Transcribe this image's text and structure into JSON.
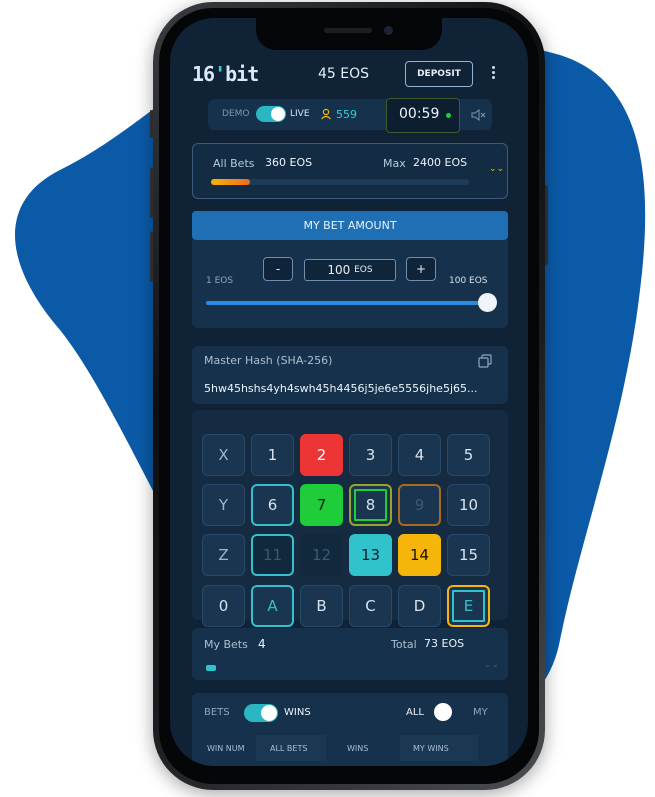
{
  "header": {
    "logo_a": "16",
    "logo_b": "bit",
    "balance": "45 EOS",
    "deposit_label": "DEPOSIT"
  },
  "mode": {
    "demo_label": "DEMO",
    "live_label": "LIVE",
    "players": "559",
    "timer": "00:59"
  },
  "all_bets": {
    "label": "All Bets",
    "value": "360 EOS",
    "max_label": "Max",
    "max_value": "2400 EOS",
    "progress": 0.15
  },
  "my_bet": {
    "title": "MY BET AMOUNT",
    "min_label": "1 EOS",
    "max_label": "100 EOS",
    "minus": "-",
    "plus": "+",
    "amount": "100",
    "unit": "EOS",
    "slider_value": 1.0
  },
  "hash": {
    "label": "Master Hash (SHA-256)",
    "value": "5hw45hshs4yh4swh45h4456j5je6e5556jhe5j65..."
  },
  "grid": {
    "cells": [
      [
        "X",
        "1",
        "2",
        "3",
        "4",
        "5"
      ],
      [
        "Y",
        "6",
        "7",
        "8",
        "9",
        "10"
      ],
      [
        "Z",
        "11",
        "12",
        "13",
        "14",
        "15"
      ],
      [
        "0",
        "A",
        "B",
        "C",
        "D",
        "E"
      ]
    ],
    "colors": {
      "red": "#ee3535",
      "green": "#1fcc3a",
      "cyan": "#31c3cc",
      "orange": "#f5b50a"
    }
  },
  "my_bets": {
    "label": "My Bets",
    "count": "4",
    "total_label": "Total",
    "total": "73 EOS",
    "progress": 0.04
  },
  "bets_section": {
    "bets_label": "BETS",
    "wins_label": "WINS",
    "all_label": "ALL",
    "my_label": "MY",
    "tabs": [
      "WIN NUM",
      "ALL BETS",
      "WINS",
      "MY WINS"
    ]
  },
  "accent_color": "#2ab6c2",
  "icons": [
    "user-icon",
    "mute-icon",
    "copy-icon",
    "chevron-down-icon",
    "menu-icon"
  ]
}
